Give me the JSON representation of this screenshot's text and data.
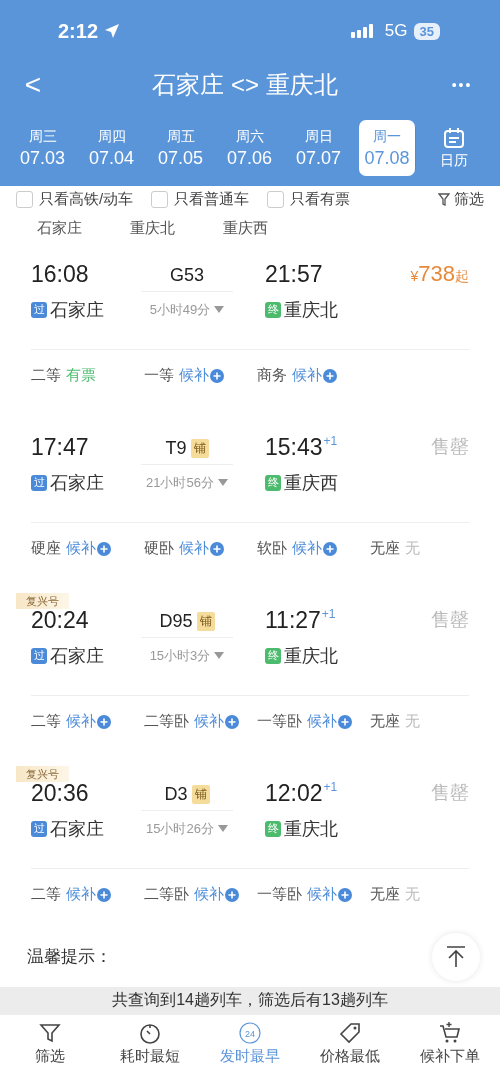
{
  "status_bar": {
    "time": "2:12",
    "network": "5G",
    "battery": "35"
  },
  "nav": {
    "back": "<",
    "title": "石家庄 <> 重庆北",
    "more": "•••"
  },
  "date_tabs": [
    {
      "weekday": "周三",
      "date": "07.03",
      "selected": false
    },
    {
      "weekday": "周四",
      "date": "07.04",
      "selected": false
    },
    {
      "weekday": "周五",
      "date": "07.05",
      "selected": false
    },
    {
      "weekday": "周六",
      "date": "07.06",
      "selected": false
    },
    {
      "weekday": "周日",
      "date": "07.07",
      "selected": false
    },
    {
      "weekday": "周一",
      "date": "07.08",
      "selected": true
    }
  ],
  "calendar_label": "日历",
  "filters": [
    {
      "label": "只看高铁/动车",
      "checked": false
    },
    {
      "label": "只看普通车",
      "checked": false
    },
    {
      "label": "只看有票",
      "checked": false
    }
  ],
  "filter_button": "筛选",
  "stations": [
    "石家庄",
    "重庆北",
    "重庆西"
  ],
  "trains": [
    {
      "depart": "16:08",
      "train_no": "G53",
      "duration": "5小时49分",
      "arrive": "21:57",
      "from_badge": "过",
      "from": "石家庄",
      "to_badge": "终",
      "to": "重庆北",
      "price_symbol": "¥",
      "price": "738",
      "price_suffix": "起",
      "seats": [
        {
          "class": "二等",
          "availability": "有票",
          "kind": "available"
        },
        {
          "class": "一等",
          "availability": "候补",
          "kind": "waitlist"
        },
        {
          "class": "商务",
          "availability": "候补",
          "kind": "waitlist"
        }
      ]
    },
    {
      "depart": "17:47",
      "train_no": "T9",
      "berth_badge": "铺",
      "duration": "21小时56分",
      "arrive": "15:43",
      "next_day": "+1",
      "from_badge": "过",
      "from": "石家庄",
      "to_badge": "终",
      "to": "重庆西",
      "status": "售罄",
      "seats": [
        {
          "class": "硬座",
          "availability": "候补",
          "kind": "waitlist"
        },
        {
          "class": "硬卧",
          "availability": "候补",
          "kind": "waitlist"
        },
        {
          "class": "软卧",
          "availability": "候补",
          "kind": "waitlist"
        },
        {
          "class": "无座",
          "availability": "无",
          "kind": "none"
        }
      ]
    },
    {
      "tag": "复兴号",
      "depart": "20:24",
      "train_no": "D95",
      "berth_badge": "铺",
      "duration": "15小时3分",
      "arrive": "11:27",
      "next_day": "+1",
      "from_badge": "过",
      "from": "石家庄",
      "to_badge": "终",
      "to": "重庆北",
      "status": "售罄",
      "seats": [
        {
          "class": "二等",
          "availability": "候补",
          "kind": "waitlist"
        },
        {
          "class": "二等卧",
          "availability": "候补",
          "kind": "waitlist"
        },
        {
          "class": "一等卧",
          "availability": "候补",
          "kind": "waitlist"
        },
        {
          "class": "无座",
          "availability": "无",
          "kind": "none"
        }
      ]
    },
    {
      "tag": "复兴号",
      "depart": "20:36",
      "train_no": "D3",
      "berth_badge": "铺",
      "duration": "15小时26分",
      "arrive": "12:02",
      "next_day": "+1",
      "from_badge": "过",
      "from": "石家庄",
      "to_badge": "终",
      "to": "重庆北",
      "status": "售罄",
      "seats": [
        {
          "class": "二等",
          "availability": "候补",
          "kind": "waitlist"
        },
        {
          "class": "二等卧",
          "availability": "候补",
          "kind": "waitlist"
        },
        {
          "class": "一等卧",
          "availability": "候补",
          "kind": "waitlist"
        },
        {
          "class": "无座",
          "availability": "无",
          "kind": "none"
        }
      ]
    }
  ],
  "tips_title": "温馨提示：",
  "toast": "共查询到14趟列车，筛选后有13趟列车",
  "bottom_nav": [
    {
      "label": "筛选",
      "selected": false
    },
    {
      "label": "耗时最短",
      "selected": false
    },
    {
      "label": "发时最早",
      "selected": true,
      "icon_text": "24"
    },
    {
      "label": "价格最低",
      "selected": false
    },
    {
      "label": "候补下单",
      "selected": false
    }
  ]
}
